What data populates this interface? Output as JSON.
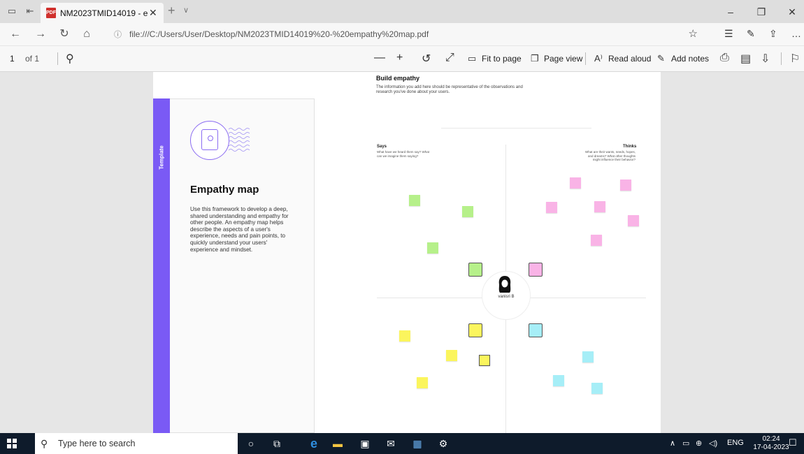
{
  "browser": {
    "tab_title": "NM2023TMID14019 - e",
    "tab_icon_label": "PDF",
    "url": "file:///C:/Users/User/Desktop/NM2023TMID14019%20-%20empathy%20map.pdf"
  },
  "pdf_toolbar": {
    "page_number": "1",
    "page_of": "of 1",
    "fit_to_page": "Fit to page",
    "page_view": "Page view",
    "read_aloud": "Read aloud",
    "add_notes": "Add notes"
  },
  "template_card": {
    "side_label": "Template",
    "title": "Empathy map",
    "description": "Use this framework to develop a deep, shared understanding and empathy for other people. An empathy map helps describe the aspects of a user's experience, needs and pain points, to quickly understand your users' experience and mindset."
  },
  "empathy": {
    "title": "Build empathy",
    "description": "The information you add here should be representative of the observations and research you've done about your users.",
    "says_title": "Says",
    "says_desc": "What have we heard them say? What can we imagine them saying?",
    "thinks_title": "Thinks",
    "thinks_desc": "What are their wants, needs, hopes, and dreams? What other thoughts might influence their behavior?",
    "user_name": "vanisri B"
  },
  "sticky_colors": {
    "says": "#b6f08a",
    "thinks": "#f9b3e6",
    "does": "#fbf55d",
    "feels": "#a6eef7"
  },
  "taskbar": {
    "search_placeholder": "Type here to search",
    "lang": "ENG",
    "time": "02:24",
    "date": "17-04-2023"
  }
}
